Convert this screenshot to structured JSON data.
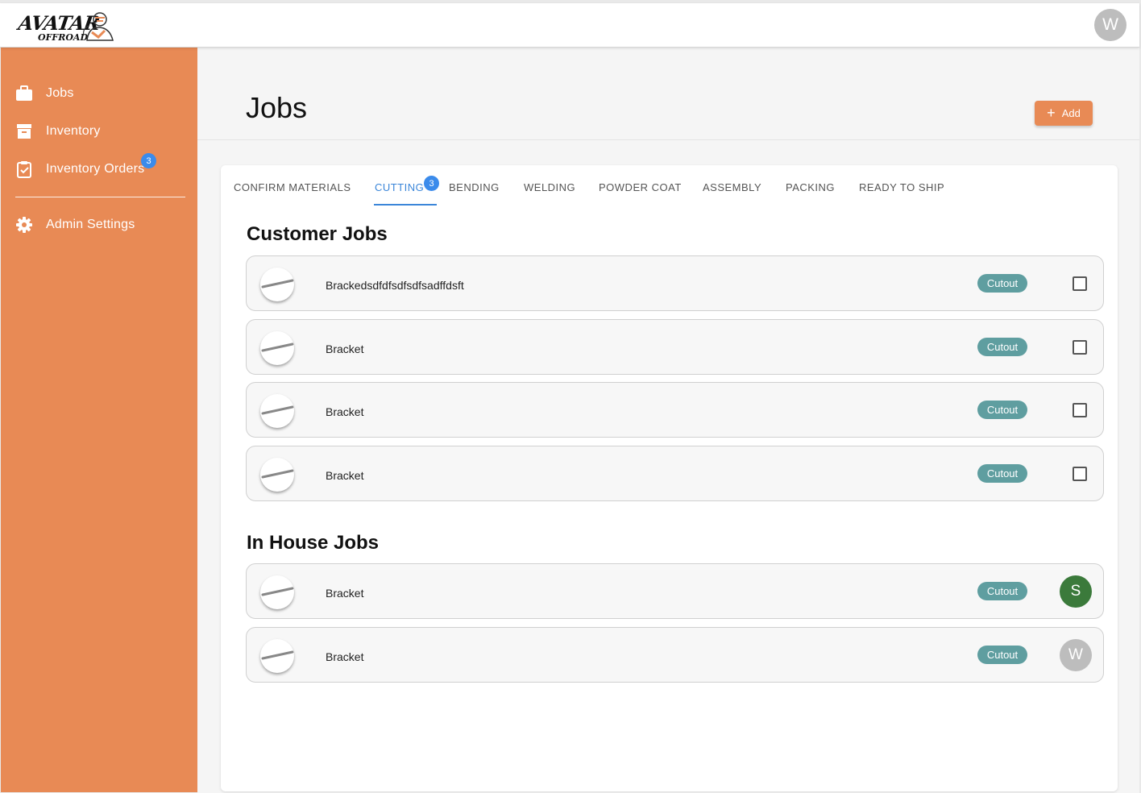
{
  "header": {
    "logo_line1": "AVATAR",
    "logo_line2": "OFFROAD",
    "user_initial": "W"
  },
  "sidebar": {
    "items": [
      {
        "label": "Jobs",
        "icon": "briefcase-icon"
      },
      {
        "label": "Inventory",
        "icon": "archive-box-icon"
      },
      {
        "label": "Inventory Orders",
        "icon": "clipboard-check-icon",
        "badge": "3"
      },
      {
        "label": "Admin Settings",
        "icon": "gear-icon"
      }
    ]
  },
  "page": {
    "title": "Jobs",
    "add_label": "Add"
  },
  "tabs": [
    {
      "label": "CONFIRM MATERIALS"
    },
    {
      "label": "CUTTING",
      "active": true,
      "badge": "3"
    },
    {
      "label": "BENDING"
    },
    {
      "label": "WELDING"
    },
    {
      "label": "POWDER COAT"
    },
    {
      "label": "ASSEMBLY"
    },
    {
      "label": "PACKING"
    },
    {
      "label": "READY TO SHIP"
    }
  ],
  "customer_jobs": {
    "title": "Customer Jobs",
    "rows": [
      {
        "name": "Brackedsdfdfsdfsdfsadffdsft",
        "status": "Cutout"
      },
      {
        "name": "Bracket",
        "status": "Cutout"
      },
      {
        "name": "Bracket",
        "status": "Cutout"
      },
      {
        "name": "Bracket",
        "status": "Cutout"
      }
    ]
  },
  "in_house_jobs": {
    "title": "In House Jobs",
    "rows": [
      {
        "name": "Bracket",
        "status": "Cutout",
        "assignee": "S",
        "assignee_color": "#3b7a3b"
      },
      {
        "name": "Bracket",
        "status": "Cutout",
        "assignee": "W",
        "assignee_color": "#bdbdbd"
      }
    ]
  },
  "colors": {
    "sidebar": "#e88a55",
    "accent": "#3b86d9",
    "chip": "#5f9ea0"
  }
}
